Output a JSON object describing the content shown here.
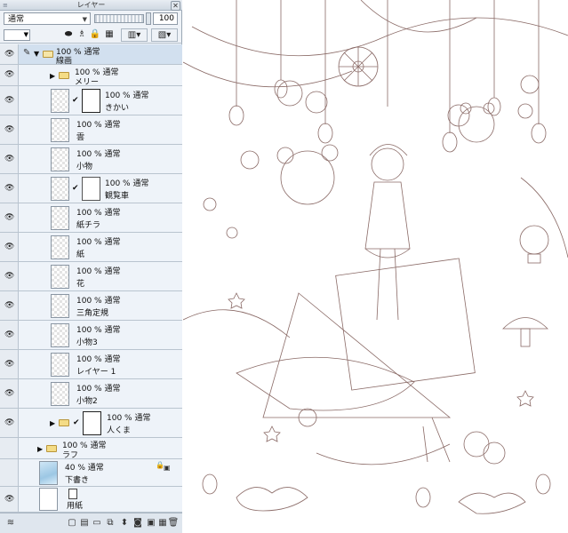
{
  "panel": {
    "title": "レイヤー",
    "close_glyph": "✕",
    "grip_glyph": "≡",
    "blend_mode": "通常",
    "opacity_value": "100"
  },
  "toolbar": {
    "icons": [
      "new-raster-icon",
      "reference-icon",
      "lock-icon",
      "lock-alpha-icon",
      "clip-icon",
      "mask-toggle-icon"
    ]
  },
  "layers": [
    {
      "id": "senga",
      "line1": "100 % 通常",
      "line2": "線画",
      "type": "folder-open"
    },
    {
      "id": "meri",
      "line1": "100 % 通常",
      "line2": "メリー",
      "type": "folder"
    },
    {
      "id": "kikai",
      "line1": "100 % 通常",
      "line2": "きかい",
      "type": "raster-mask"
    },
    {
      "id": "kumo",
      "line1": "100 % 通常",
      "line2": "雲",
      "type": "raster"
    },
    {
      "id": "komono",
      "line1": "100 % 通常",
      "line2": "小物",
      "type": "raster"
    },
    {
      "id": "kanransha",
      "line1": "100 % 通常",
      "line2": "観覧車",
      "type": "raster-mask"
    },
    {
      "id": "kamichira",
      "line1": "100 % 通常",
      "line2": "紙チラ",
      "type": "raster"
    },
    {
      "id": "kami",
      "line1": "100 % 通常",
      "line2": "紙",
      "type": "raster"
    },
    {
      "id": "hana",
      "line1": "100 % 通常",
      "line2": "花",
      "type": "raster"
    },
    {
      "id": "sankaku",
      "line1": "100 % 通常",
      "line2": "三角定規",
      "type": "raster"
    },
    {
      "id": "komono3",
      "line1": "100 % 通常",
      "line2": "小物3",
      "type": "raster"
    },
    {
      "id": "layer1",
      "line1": "100 % 通常",
      "line2": "レイヤー 1",
      "type": "raster"
    },
    {
      "id": "komono2",
      "line1": "100 % 通常",
      "line2": "小物2",
      "type": "raster"
    },
    {
      "id": "kuma",
      "line1": "100 % 通常",
      "line2": "人くま",
      "type": "folder-mask"
    },
    {
      "id": "rafu",
      "line1": "100 % 通常",
      "line2": "ラフ",
      "type": "folder"
    },
    {
      "id": "shitagaki",
      "line1": "40 % 通常",
      "line2": "下書き",
      "type": "sketch"
    },
    {
      "id": "youshi",
      "line1": "",
      "line2": "用紙",
      "type": "paper"
    }
  ],
  "bottom": {
    "icons": [
      "layer-settings-icon",
      "new-raster-layer-icon",
      "new-vector-layer-icon",
      "new-folder-icon",
      "copy-layer-icon",
      "merge-down-icon",
      "mask-icon",
      "reference-layer-icon",
      "delete-layer-icon"
    ]
  },
  "canvas": {
    "description_icon": "line-art-illustration"
  }
}
